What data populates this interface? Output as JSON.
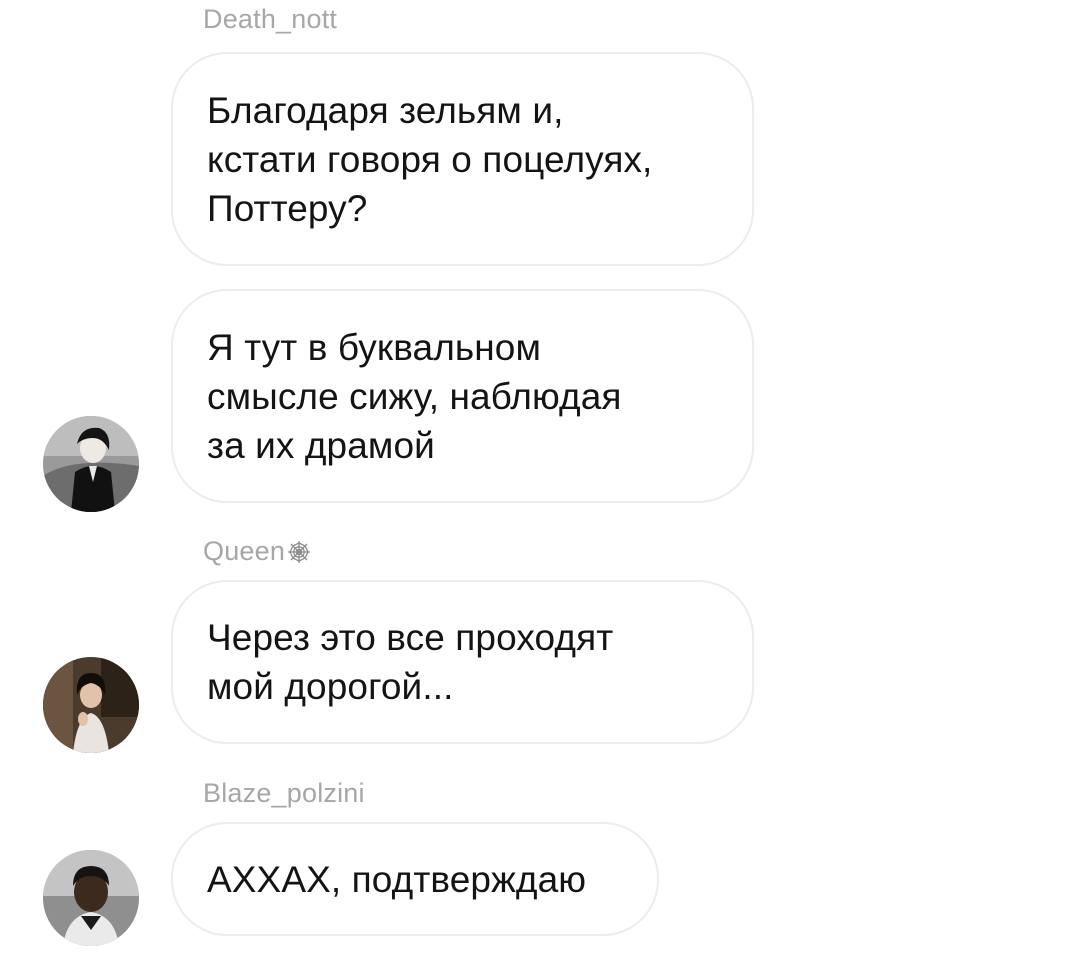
{
  "chat": {
    "messages": [
      {
        "sender": "Death_nott",
        "text": "Благодаря зельям и,\nкстати говоря о поцелуях,\nПоттеру?"
      },
      {
        "sender": "",
        "text": "Я тут в буквальном\nсмысле сижу, наблюдая\nза их драмой",
        "avatar": "avatar-death-nott"
      },
      {
        "sender": "Queen",
        "sender_icon": "spiderweb-icon",
        "text": "Через это все проходят\nмой дорогой...",
        "avatar": "avatar-queen"
      },
      {
        "sender": "Blaze_polzini",
        "text": "АХХАХ, подтверждаю",
        "avatar": "avatar-blaze-polzini"
      }
    ]
  },
  "colors": {
    "background": "#ffffff",
    "bubble_border": "#ececec",
    "sender_name": "#a7a7a7",
    "message_text": "#141414"
  }
}
